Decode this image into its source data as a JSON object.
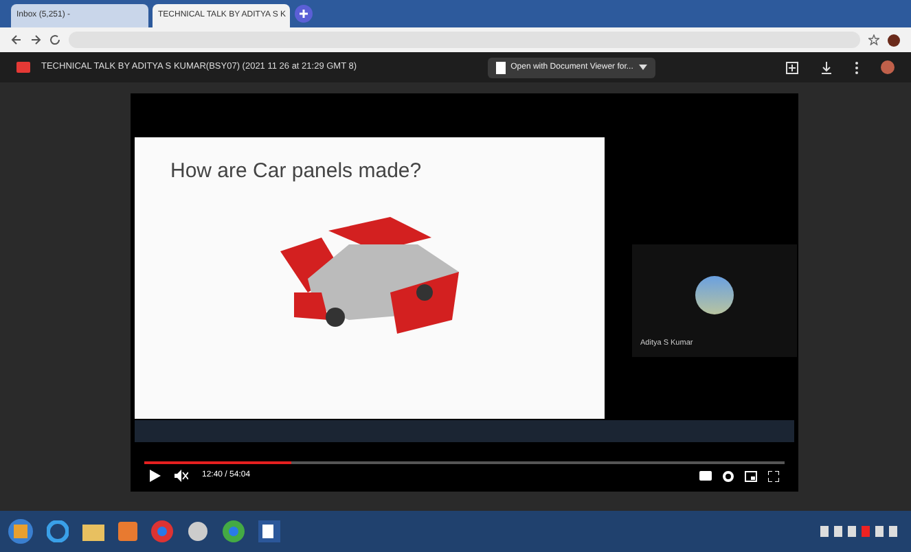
{
  "browser": {
    "tabs": [
      {
        "title": "Inbox (5,251) - ",
        "selected": false
      },
      {
        "title": "TECHNICAL TALK BY ADITYA S K",
        "selected": true
      }
    ]
  },
  "drive_header": {
    "title": "TECHNICAL TALK BY ADITYA S KUMAR(BSY07) (2021 11 26 at 21:29 GMT 8)",
    "open_with": "Open with Document Viewer for..."
  },
  "slide": {
    "title": "How are Car panels made?"
  },
  "participant": {
    "name": "Aditya S Kumar"
  },
  "player": {
    "level": 0.23,
    "time": "12:40 / 54:04"
  }
}
